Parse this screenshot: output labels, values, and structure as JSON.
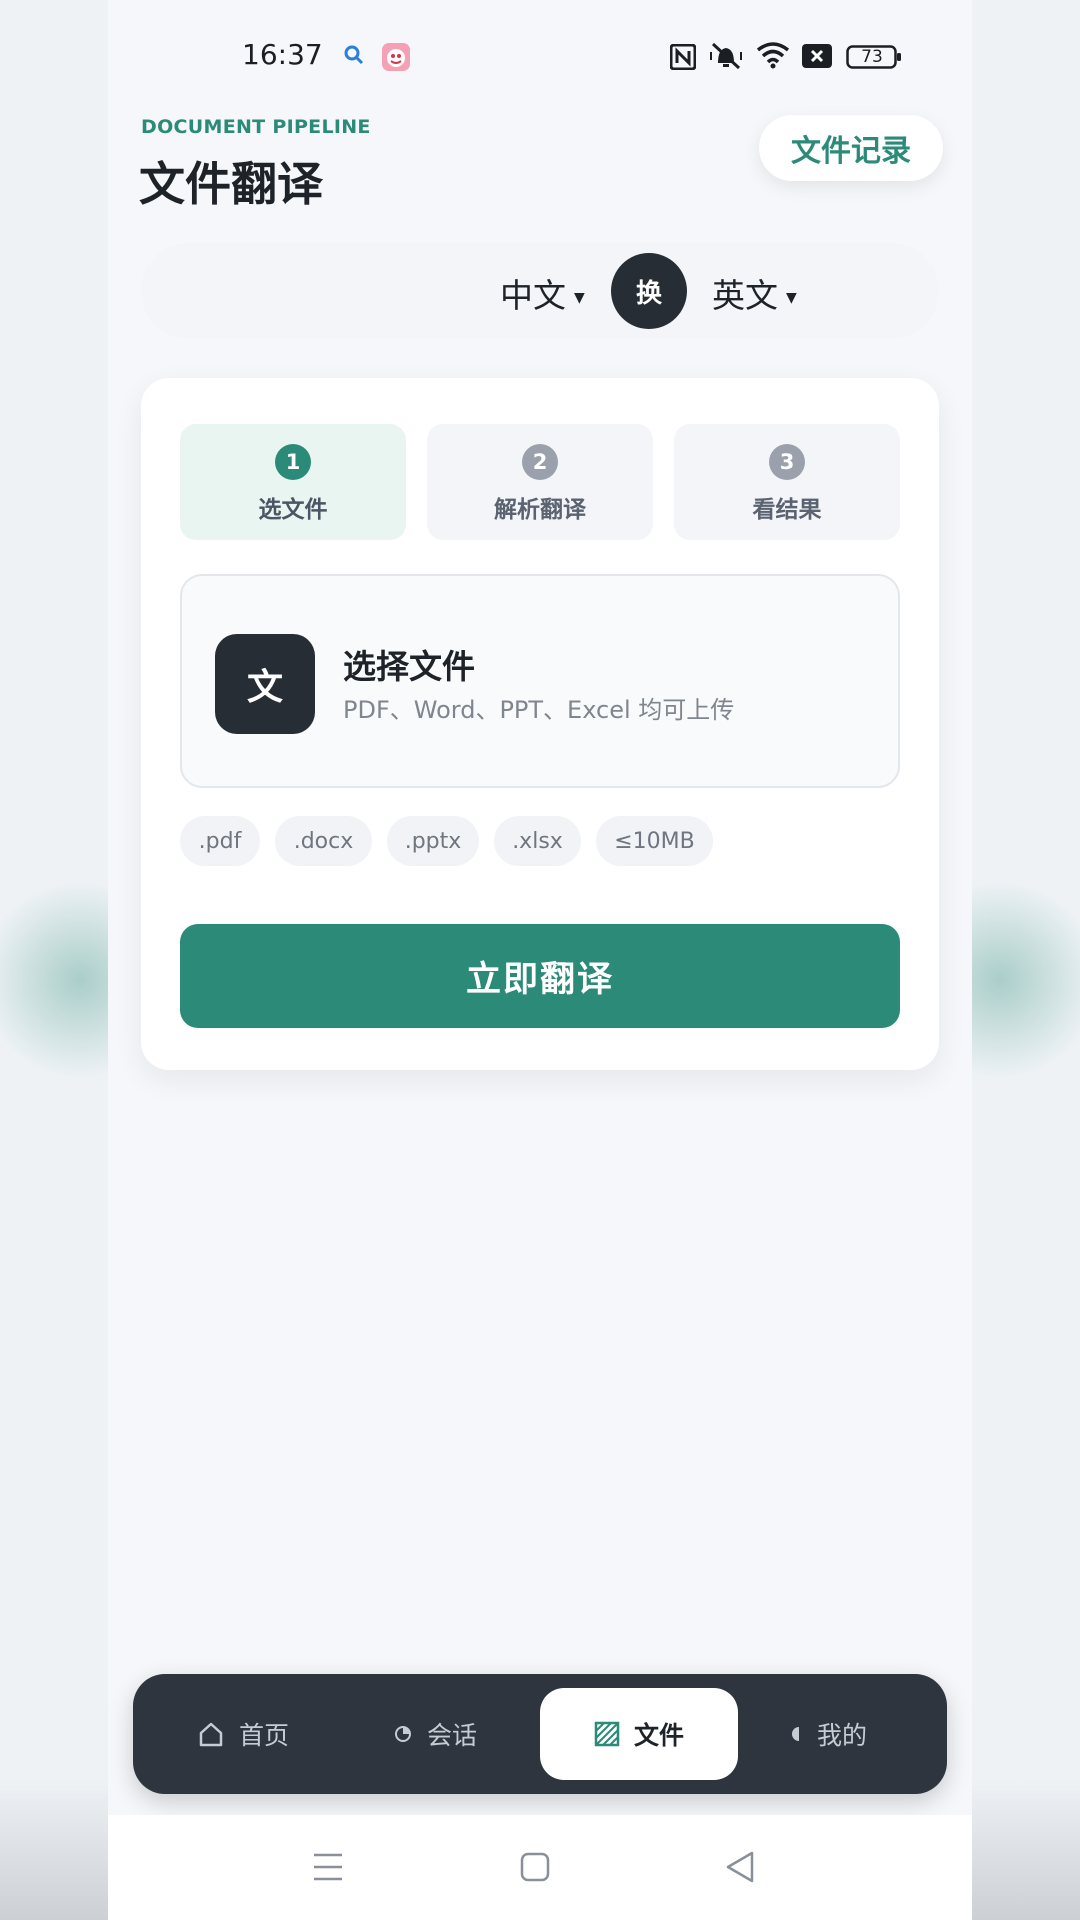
{
  "status_bar": {
    "time": "16:37",
    "battery": "73",
    "icons": [
      "search-icon",
      "app-mascot-icon",
      "nfc-icon",
      "vibrate-mute-icon",
      "wifi-icon",
      "close-box-icon",
      "battery-icon"
    ]
  },
  "header": {
    "eyebrow": "DOCUMENT PIPELINE",
    "title": "文件翻译",
    "history_button": "文件记录"
  },
  "language": {
    "source": "中文",
    "target": "英文",
    "swap_label": "换"
  },
  "steps": [
    {
      "number": "1",
      "label": "选文件",
      "active": true
    },
    {
      "number": "2",
      "label": "解析翻译",
      "active": false
    },
    {
      "number": "3",
      "label": "看结果",
      "active": false
    }
  ],
  "upload": {
    "icon_glyph": "文",
    "title": "选择文件",
    "subtitle": "PDF、Word、PPT、Excel 均可上传"
  },
  "file_types": [
    ".pdf",
    ".docx",
    ".pptx",
    ".xlsx",
    "≤10MB"
  ],
  "primary_button": "立即翻译",
  "tabbar": {
    "items": [
      {
        "label": "首页",
        "icon": "home-icon",
        "active": false
      },
      {
        "label": "会话",
        "icon": "chat-icon",
        "active": false
      },
      {
        "label": "文件",
        "icon": "file-icon",
        "active": true
      },
      {
        "label": "我的",
        "icon": "profile-icon",
        "active": false
      }
    ]
  },
  "colors": {
    "accent": "#2b8a78",
    "dark": "#262d35",
    "tabbar": "#2e353e",
    "background": "#f5f7fa"
  }
}
